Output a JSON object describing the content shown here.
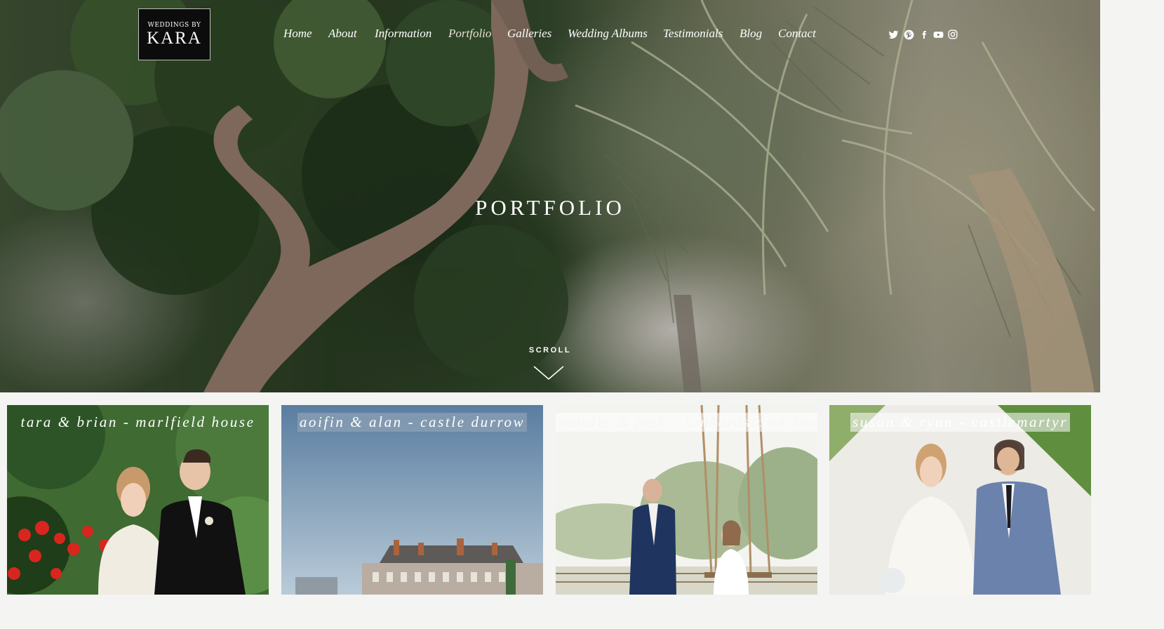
{
  "logo": {
    "line1": "WEDDINGS BY",
    "line2": "KARA"
  },
  "nav": [
    {
      "label": "Home"
    },
    {
      "label": "About"
    },
    {
      "label": "Information"
    },
    {
      "label": "Portfolio",
      "active": true
    },
    {
      "label": "Galleries"
    },
    {
      "label": "Wedding Albums"
    },
    {
      "label": "Testimonials"
    },
    {
      "label": "Blog"
    },
    {
      "label": "Contact"
    }
  ],
  "social": [
    "twitter-icon",
    "pinterest-icon",
    "facebook-icon",
    "youtube-icon",
    "instagram-icon"
  ],
  "hero": {
    "title": "PORTFOLIO",
    "scroll_label": "SCROLL"
  },
  "gallery": [
    {
      "caption": "tara & brian - marlfield house"
    },
    {
      "caption": "aoifin & alan - castle durrow"
    },
    {
      "caption": "natalie & josh - tankardstown house"
    },
    {
      "caption": "susan & ryan - castlemartyr"
    }
  ],
  "colors": {
    "text": "#ffffff",
    "page_bg": "#f4f4f2",
    "logo_bg": "#0c0c0c"
  }
}
